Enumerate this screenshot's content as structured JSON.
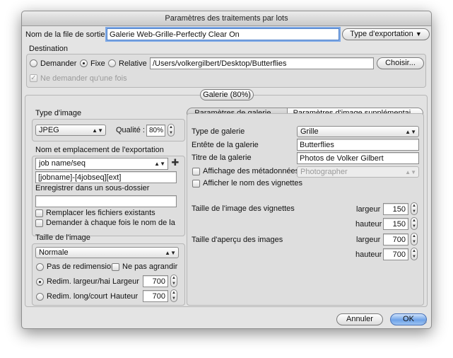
{
  "dialog": {
    "title": "Paramètres des traitements par lots",
    "output_name_label": "Nom de la file de sortie",
    "output_name_value": "Galerie Web-Grille-Perfectly Clear On",
    "export_type_button": "Type d'exportation",
    "cancel_button": "Annuler",
    "ok_button": "OK"
  },
  "destination": {
    "label": "Destination",
    "options": [
      "Demander",
      "Fixe",
      "Relative"
    ],
    "selected": "Fixe",
    "path": "/Users/volkergilbert/Desktop/Butterflies",
    "choose_button": "Choisir...",
    "ask_once_label": "Ne demander qu'une fois",
    "ask_once_checked": true
  },
  "gallery_button": "Galerie (80%)",
  "left": {
    "image_type_label": "Type d'image",
    "image_type_value": "JPEG",
    "quality_label": "Qualité :",
    "quality_value": "80%",
    "export_name_label": "Nom et emplacement de l'exportation",
    "name_combo_value": "job name/seq",
    "name_pattern_value": "[jobname]-[4jobseq][ext]",
    "subfolder_label": "Enregistrer dans un sous-dossier",
    "subfolder_value": "",
    "replace_label": "Remplacer les fichiers existants",
    "ask_name_label": "Demander à chaque fois le nom de la",
    "image_size_label": "Taille de l'image",
    "image_size_value": "Normale",
    "no_resize_label": "Pas de redimensior",
    "no_enlarge_label": "Ne pas agrandir",
    "resize_wh_label": "Redim. largeur/hai",
    "resize_lc_label": "Redim. long/court",
    "width_label": "Largeur",
    "width_value": "700",
    "height_label": "Hauteur",
    "height_value": "700"
  },
  "right": {
    "tab_gallery": "Paramètres de galerie ...",
    "tab_image": "Paramètres d'image supplémentai...",
    "gallery_type_label": "Type de galerie",
    "gallery_type_value": "Grille",
    "header_label": "Entête de la galerie",
    "header_value": "Butterflies",
    "title_label": "Titre de la galerie",
    "title_value": "Photos de Volker Gilbert",
    "metadata_label": "Affichage des métadonnées",
    "metadata_value": "Photographer",
    "show_names_label": "Afficher le nom des vignettes",
    "thumb_size_label": "Taille de l'image des vignettes",
    "preview_size_label": "Taille d'aperçu des images",
    "width_label": "largeur",
    "height_label": "hauteur",
    "thumb_width": "150",
    "thumb_height": "150",
    "preview_width": "700",
    "preview_height": "700"
  }
}
